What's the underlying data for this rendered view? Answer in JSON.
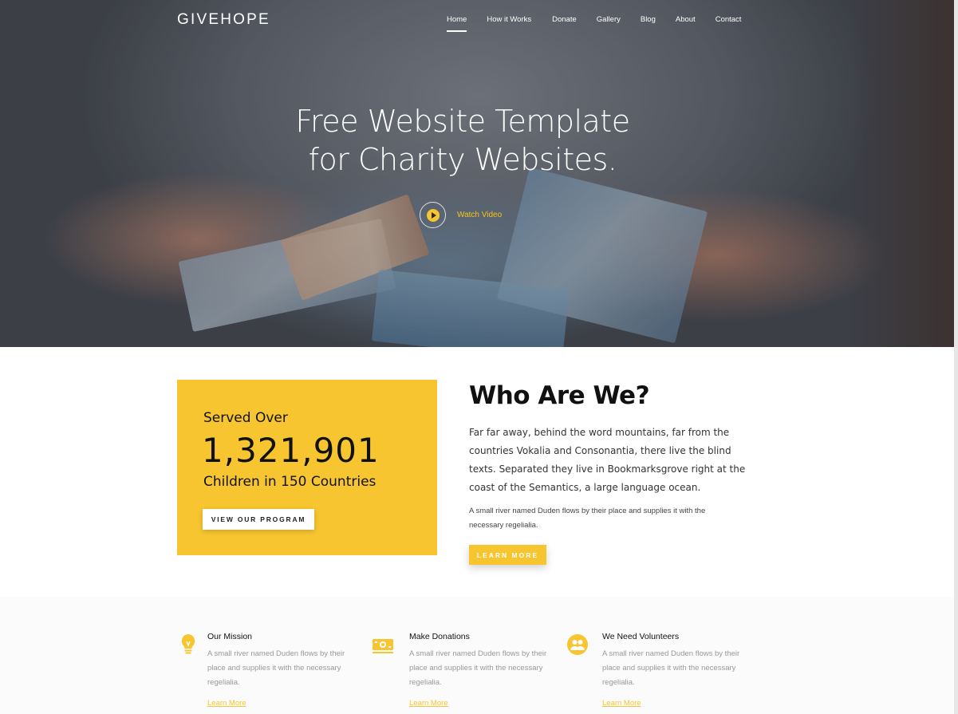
{
  "nav": {
    "brand": "GIVEHOPE",
    "items": [
      {
        "label": "Home",
        "active": true
      },
      {
        "label": "How it Works",
        "active": false
      },
      {
        "label": "Donate",
        "active": false
      },
      {
        "label": "Gallery",
        "active": false
      },
      {
        "label": "Blog",
        "active": false
      },
      {
        "label": "About",
        "active": false
      },
      {
        "label": "Contact",
        "active": false
      }
    ]
  },
  "hero": {
    "title_line1": "Free Website Template",
    "title_line2": "for Charity Websites.",
    "watch_label": "Watch Video"
  },
  "stats": {
    "served_over": "Served Over",
    "number": "1,321,901",
    "children": "Children in 150 Countries",
    "button": "VIEW OUR PROGRAM"
  },
  "who": {
    "title": "Who Are We?",
    "paragraph1": "Far far away, behind the word mountains, far from the countries Vokalia and Consonantia, there live the blind texts. Separated they live in Bookmarksgrove right at the coast of the Semantics, a large language ocean.",
    "paragraph2": "A small river named Duden flows by their place and supplies it with the necessary regelialia.",
    "button": "LEARN MORE"
  },
  "features": [
    {
      "icon": "lightbulb-icon",
      "title": "Our Mission",
      "desc": "A small river named Duden flows by their place and supplies it with the necessary regelialia.",
      "link": "Learn More"
    },
    {
      "icon": "money-icon",
      "title": "Make Donations",
      "desc": "A small river named Duden flows by their place and supplies it with the necessary regelialia.",
      "link": "Learn More"
    },
    {
      "icon": "volunteers-icon",
      "title": "We Need Volunteers",
      "desc": "A small river named Duden flows by their place and supplies it with the necessary regelialia.",
      "link": "Learn More"
    }
  ],
  "colors": {
    "accent": "#f7c52f",
    "text_dark": "#111111",
    "muted": "#999999"
  }
}
